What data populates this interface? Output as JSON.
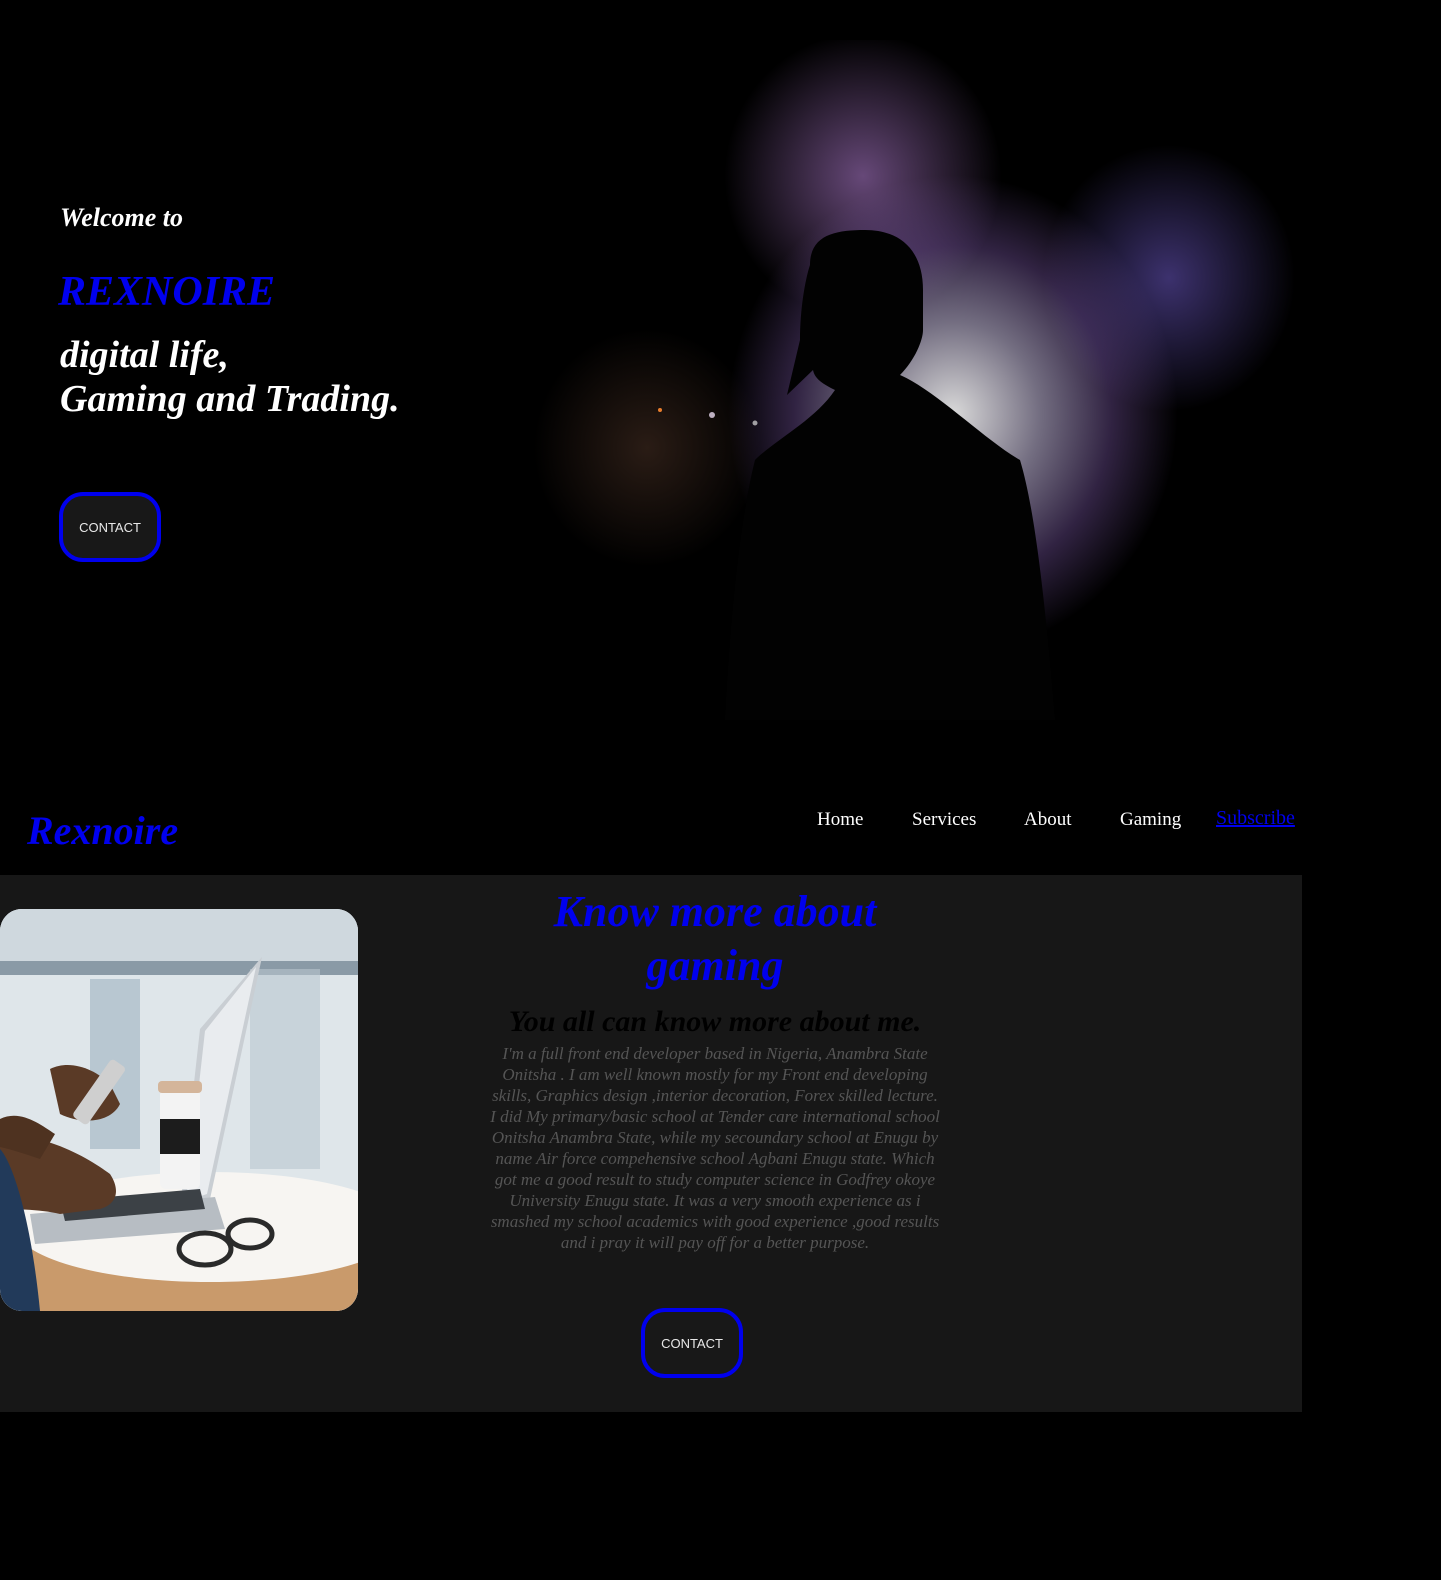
{
  "hero": {
    "welcome": "Welcome to",
    "brand": "REXNOIRE",
    "tagline_line1": "digital life,",
    "tagline_line2": "Gaming and Trading.",
    "contact_label": "CONTACT"
  },
  "nav": {
    "logo": "Rexnoire",
    "items": [
      "Home",
      "Services",
      "About",
      "Gaming"
    ],
    "subscribe": "Subscribe"
  },
  "about": {
    "title": "Know more about gaming",
    "subtitle": "You all can know more about me.",
    "body": "I'm a full front end developer based in Nigeria, Anambra State Onitsha . I am well known mostly for my Front end developing skills, Graphics design ,interior decoration, Forex skilled lecture. I did My primary/basic school at Tender care international school Onitsha Anambra State, while my secoundary school at Enugu by name Air force compehensive school Agbani Enugu state. Which got me a good result to study computer science in Godfrey okoye University Enugu state. It was a very smooth experience as i smashed my school academics with good experience ,good results and i pray it will pay off for a better purpose.",
    "contact_label": "CONTACT"
  },
  "colors": {
    "accent": "#0000ee",
    "page_bg": "#000000",
    "section_bg": "#171717"
  },
  "images": {
    "hero": "silhouette-in-smoke-photo",
    "about": "laptop-and-phone-photo"
  }
}
